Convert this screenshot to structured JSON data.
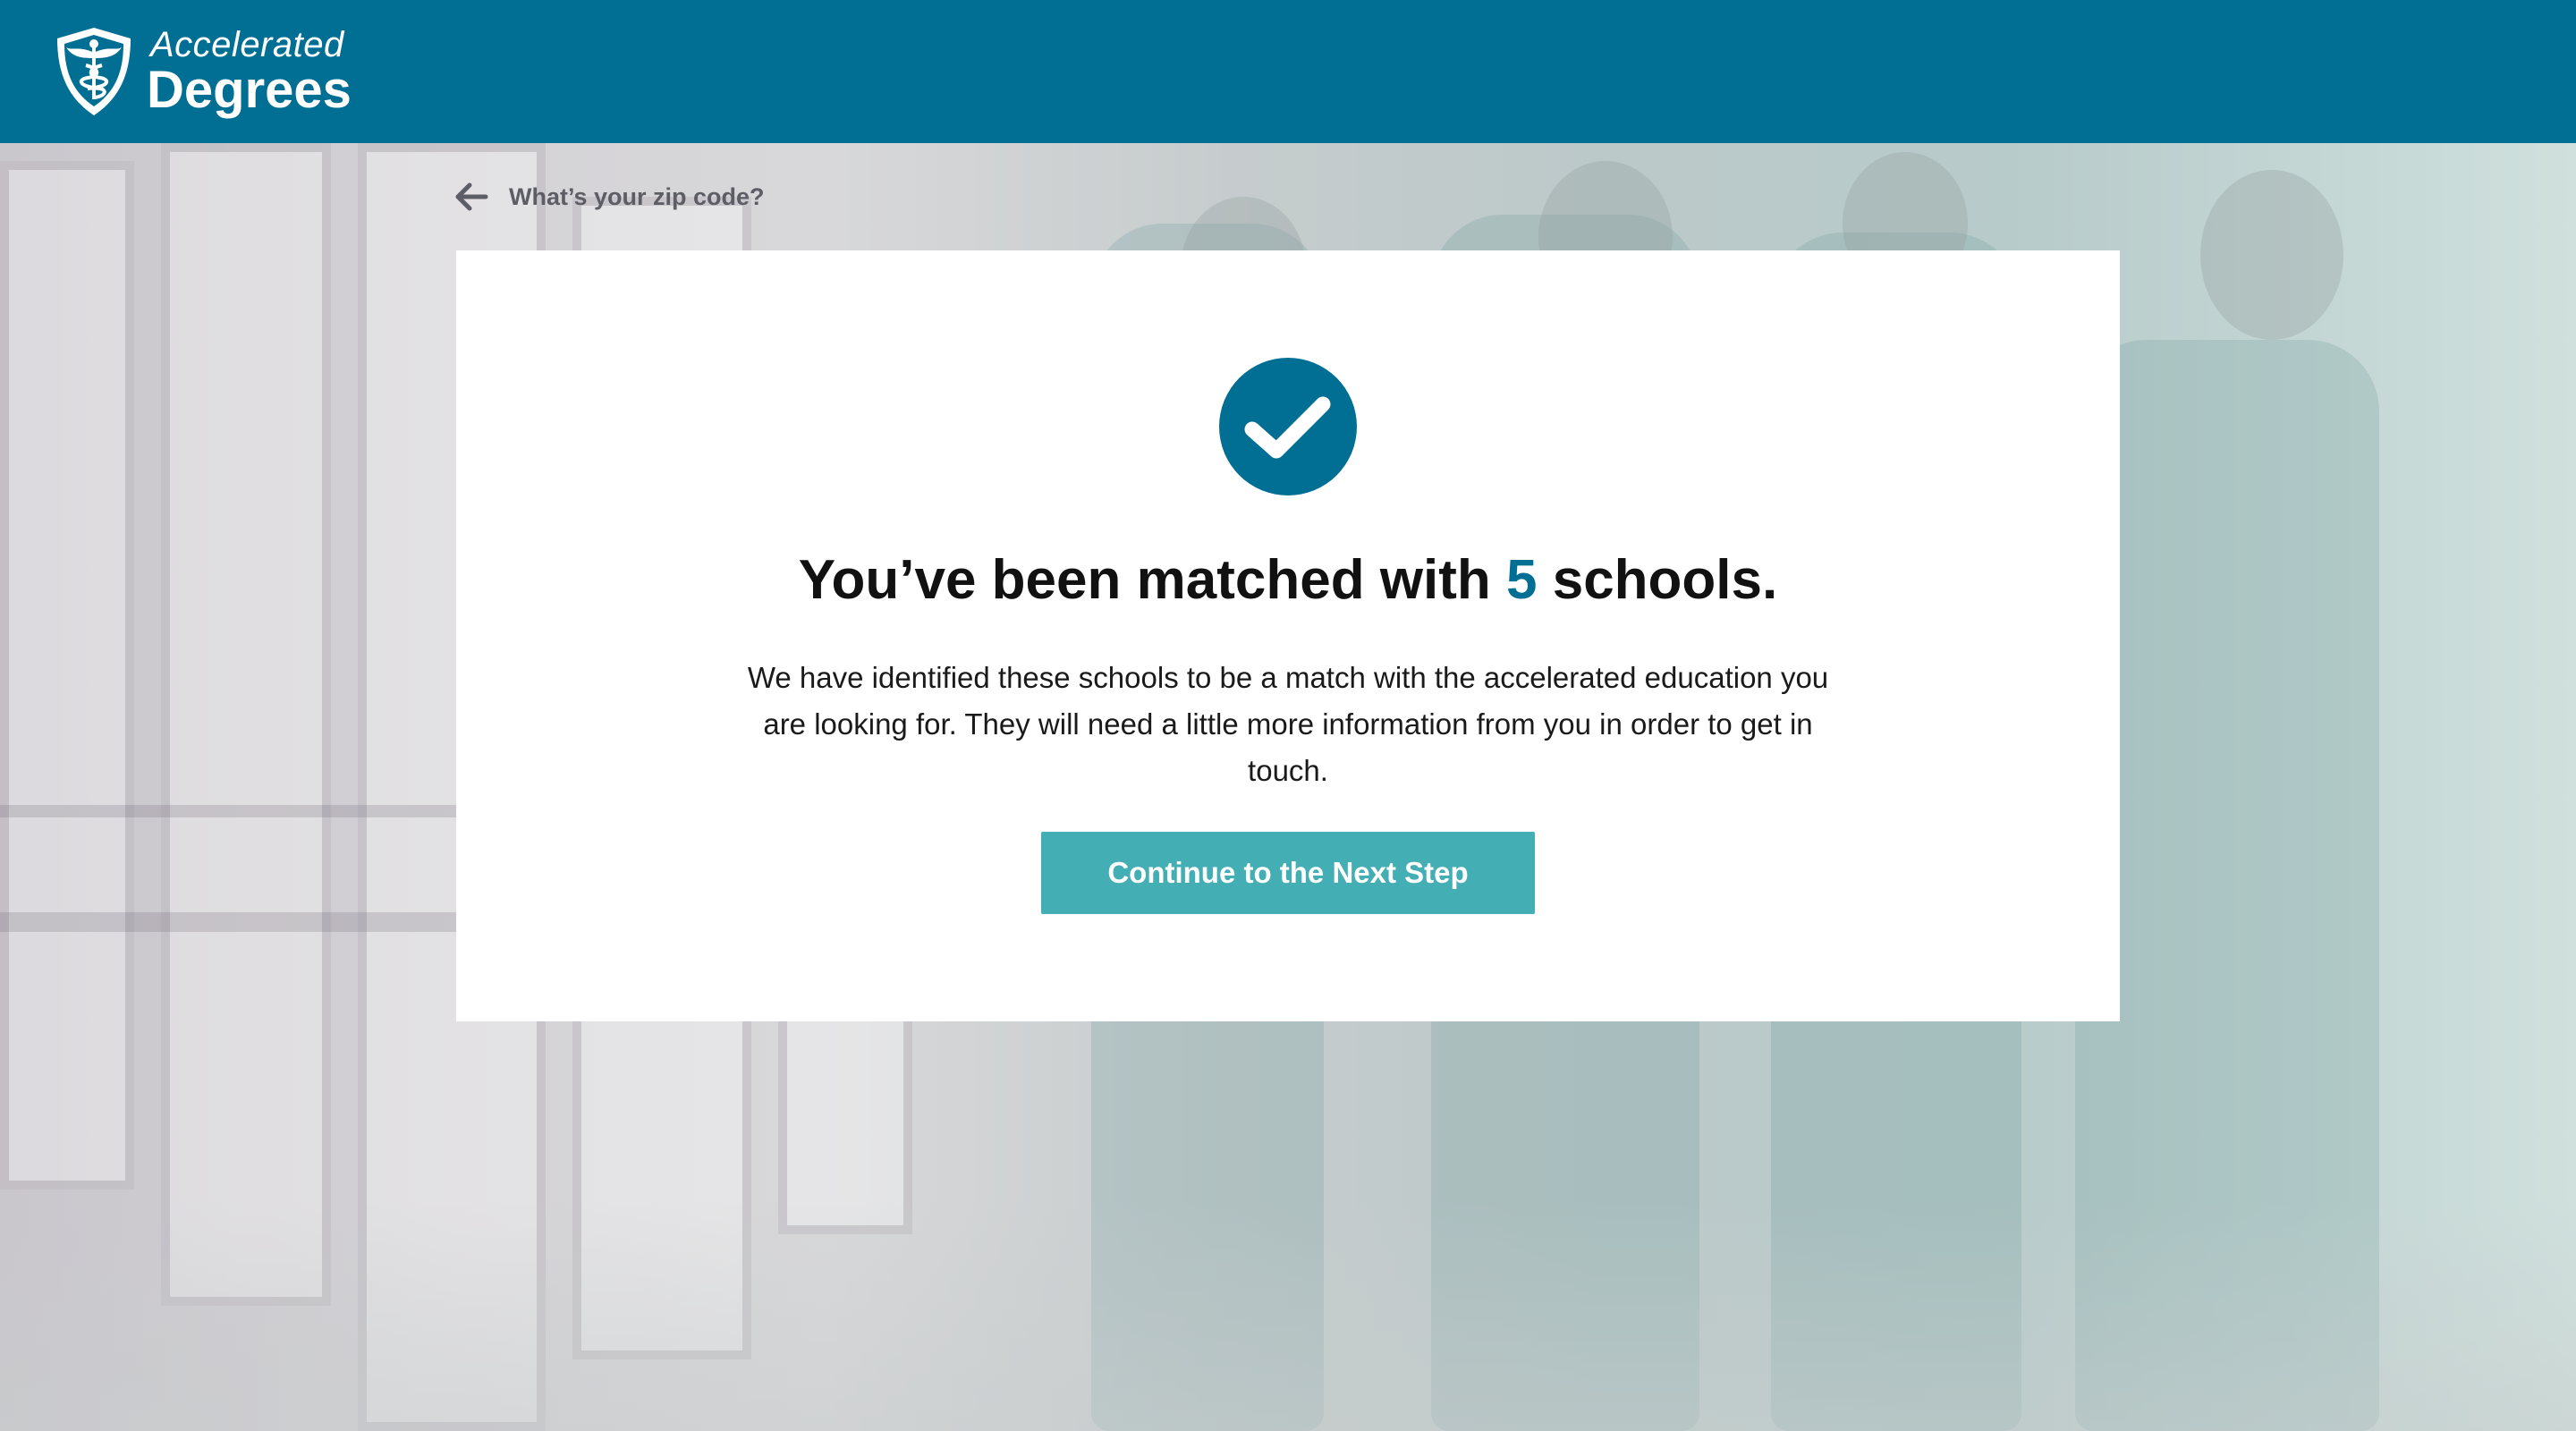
{
  "header": {
    "logo_top": "Accelerated",
    "logo_bottom": "Degrees",
    "background_color": "#006f93"
  },
  "navigation": {
    "back_label": "What’s your zip code?",
    "back_icon": "arrow-left-icon"
  },
  "result": {
    "status_icon": "checkmark-circle-icon",
    "headline_prefix": "You’ve been matched with ",
    "match_count": "5",
    "headline_suffix": " schools.",
    "description": "We have identified these schools to be a match with the accelerated education you are looking for. They will need a little more information from you in order to get in touch.",
    "cta_label": "Continue to the Next Step"
  },
  "colors": {
    "brand": "#006f93",
    "cta": "#43aeb3",
    "card": "#ffffff"
  }
}
